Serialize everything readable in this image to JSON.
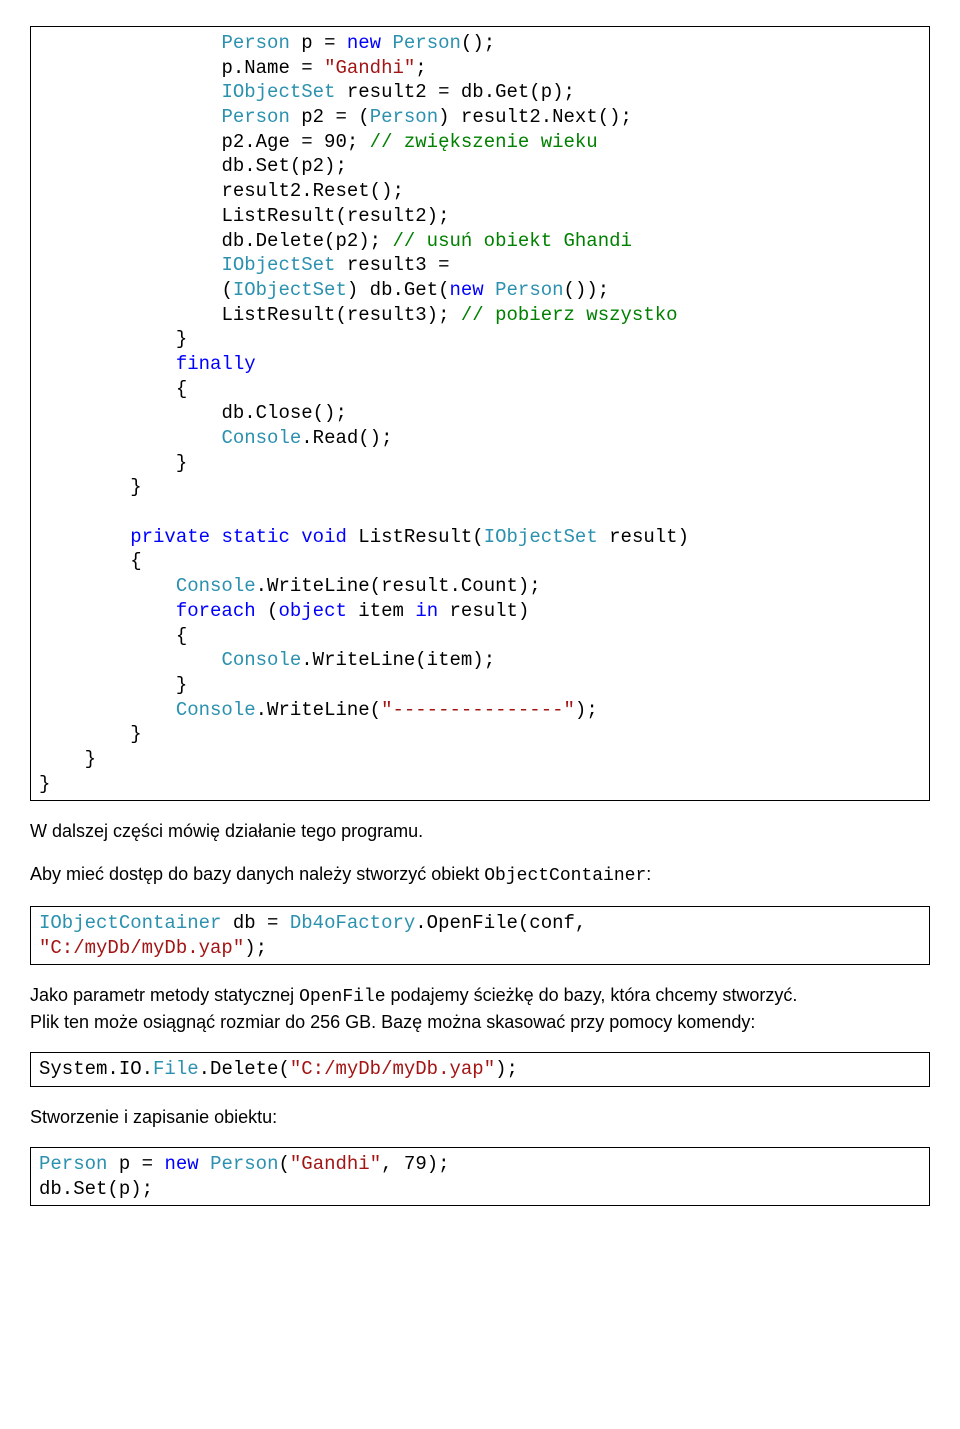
{
  "code1": {
    "l1_a": "Person",
    "l1_b": " p = ",
    "l1_c": "new",
    "l1_d": " ",
    "l1_e": "Person",
    "l1_f": "();",
    "l2": "p.Name = ",
    "l2_str": "\"Gandhi\"",
    "l2_end": ";",
    "l3_a": "IObjectSet",
    "l3_b": " result2 = db.Get(p);",
    "l4_a": "Person",
    "l4_b": " p2 = (",
    "l4_c": "Person",
    "l4_d": ") result2.Next();",
    "l5_a": "p2.Age = 90; ",
    "l5_cmt": "// zwiększenie wieku",
    "l6": "db.Set(p2);",
    "l7": "result2.Reset();",
    "l8": "ListResult(result2);",
    "l9_a": "db.Delete(p2); ",
    "l9_cmt": "// usuń obiekt Ghandi",
    "l10_a": "IObjectSet",
    "l10_b": " result3 =",
    "l11_a": "(",
    "l11_b": "IObjectSet",
    "l11_c": ") db.Get(",
    "l11_d": "new",
    "l11_e": " ",
    "l11_f": "Person",
    "l11_g": "());",
    "l12_a": "ListResult(result3); ",
    "l12_cmt": "// pobierz wszystko",
    "l13": "}",
    "l14": "finally",
    "l15": "{",
    "l16": "db.Close();",
    "l17_a": "Console",
    "l17_b": ".Read();",
    "l18": "}",
    "l19": "}",
    "l20_a": "private",
    "l20_b": " ",
    "l20_c": "static",
    "l20_d": " ",
    "l20_e": "void",
    "l20_f": " ListResult(",
    "l20_g": "IObjectSet",
    "l20_h": " result)",
    "l21": "{",
    "l22_a": "Console",
    "l22_b": ".WriteLine(result.Count);",
    "l23_a": "foreach",
    "l23_b": " (",
    "l23_c": "object",
    "l23_d": " item ",
    "l23_e": "in",
    "l23_f": " result)",
    "l24": "{",
    "l25_a": "Console",
    "l25_b": ".WriteLine(item);",
    "l26": "}",
    "l27_a": "Console",
    "l27_b": ".WriteLine(",
    "l27_str": "\"---------------\"",
    "l27_c": ");",
    "l28": "}",
    "l29": "}",
    "l30": "}"
  },
  "para1": "W dalszej części mówię działanie tego programu.",
  "para2_a": "Aby mieć dostęp do bazy danych należy stworzyć obiekt ",
  "para2_b": "ObjectContainer",
  "para2_c": ":",
  "code2": {
    "l1_a": "IObjectContainer",
    "l1_b": " db = ",
    "l1_c": "Db4oFactory",
    "l1_d": ".OpenFile(conf,",
    "l2_str": "\"C:/myDb/myDb.yap\"",
    "l2_end": ");"
  },
  "para3_a": "Jako parametr metody statycznej ",
  "para3_b": "OpenFile",
  "para3_c": " podajemy ścieżkę do bazy, która chcemy stworzyć.",
  "para3_d": "Plik ten może osiągnąć rozmiar do 256 GB. Bazę można skasować przy pomocy komendy:",
  "code3": {
    "l1_a": "System.IO.",
    "l1_b": "File",
    "l1_c": ".Delete(",
    "l1_str": "\"C:/myDb/myDb.yap\"",
    "l1_d": ");"
  },
  "para4": "Stworzenie i zapisanie obiektu:",
  "code4": {
    "l1_a": "Person",
    "l1_b": " p = ",
    "l1_c": "new",
    "l1_d": " ",
    "l1_e": "Person",
    "l1_f": "(",
    "l1_str": "\"Gandhi\"",
    "l1_g": ", 79);",
    "l2": "db.Set(p);"
  }
}
